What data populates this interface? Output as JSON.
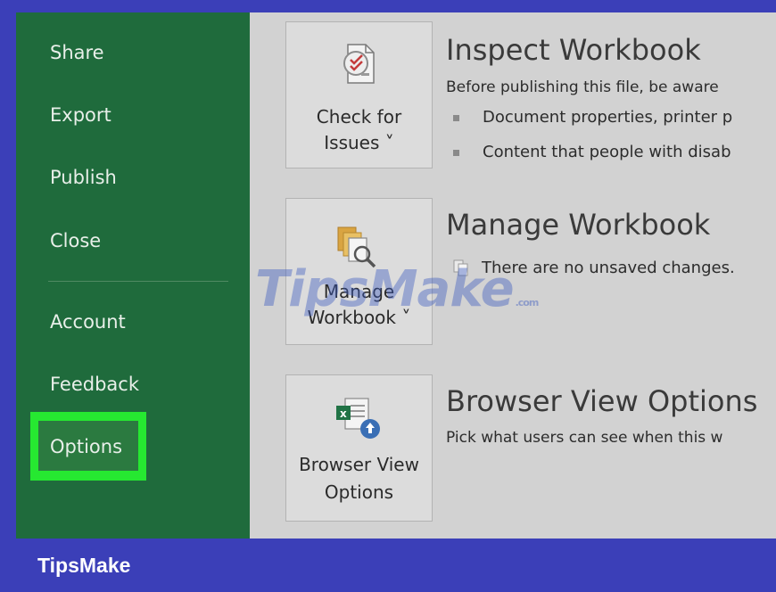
{
  "sidebar": {
    "items": [
      {
        "label": "Share"
      },
      {
        "label": "Export"
      },
      {
        "label": "Publish"
      },
      {
        "label": "Close"
      },
      {
        "label": "Account"
      },
      {
        "label": "Feedback"
      },
      {
        "label": "Options"
      }
    ],
    "highlighted_item": "Options",
    "highlight_color": "#26e831"
  },
  "sections": [
    {
      "button": {
        "line1": "Check for",
        "line2": "Issues ˅"
      },
      "title": "Inspect Workbook",
      "description": "Before publishing this file, be aware",
      "bullets": [
        "Document properties, printer p",
        "Content that people with disab"
      ]
    },
    {
      "button": {
        "line1": "Manage",
        "line2": "Workbook ˅"
      },
      "title": "Manage Workbook",
      "info": "There are no unsaved changes."
    },
    {
      "button": {
        "line1": "Browser View",
        "line2": "Options"
      },
      "title": "Browser View Options",
      "description": "Pick what users can see when this w"
    }
  ],
  "watermark": {
    "text": "TipsMake",
    "suffix": ".com"
  },
  "footer": {
    "brand": "TipsMake"
  },
  "colors": {
    "sidebar_bg": "#1f6b3c",
    "frame": "#3b3fb8",
    "content_bg": "#d2d2d2"
  }
}
